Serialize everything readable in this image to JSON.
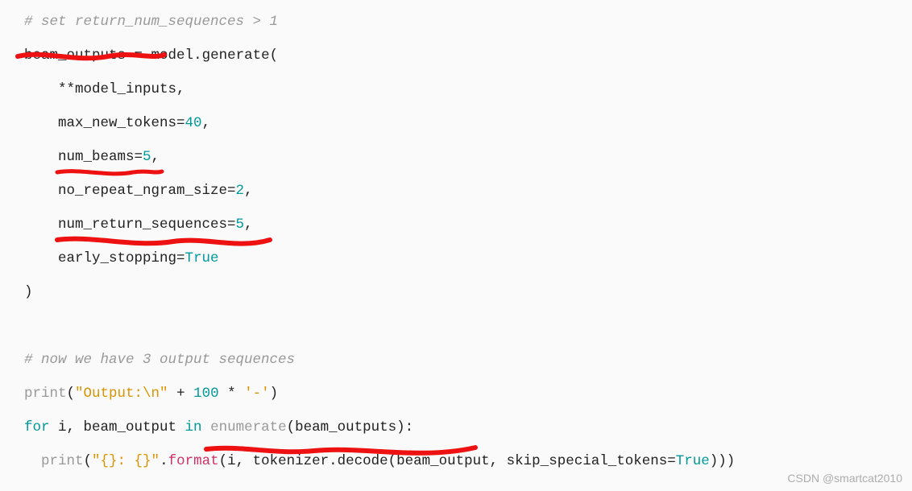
{
  "code": {
    "c1": "# set return_num_sequences > 1",
    "l1a": "beam_outputs ",
    "l1b": "=",
    "l1c": " model",
    "l1d": ".",
    "l1e": "generate",
    "l1f": "(",
    "l2a": "    **model_inputs",
    "l2b": ",",
    "l3a": "    max_new_tokens=",
    "l3b": "40",
    "l3c": ",",
    "l4a": "    num_beams=",
    "l4b": "5",
    "l4c": ",",
    "l5a": "    no_repeat_ngram_size=",
    "l5b": "2",
    "l5c": ",",
    "l6a": "    num_return_sequences=",
    "l6b": "5",
    "l6c": ",",
    "l7a": "    early_stopping=",
    "l7b": "True",
    "l8": ")",
    "blank": "",
    "c2": "# now we have 3 output sequences",
    "p1a": "print",
    "p1b": "(",
    "p1c": "\"Output:\\n\"",
    "p1d": " + ",
    "p1e": "100",
    "p1f": " * ",
    "p1g": "'-'",
    "p1h": ")",
    "f1a": "for",
    "f1b": " i, beam_output ",
    "f1c": "in",
    "f1d": " ",
    "f1e": "enumerate",
    "f1f": "(beam_outputs):",
    "g1a": "  ",
    "g1b": "print",
    "g1c": "(",
    "g1d": "\"{}: {}\"",
    "g1e": ".",
    "g1f": "format",
    "g1g": "(i, tokenizer",
    "g1h": ".",
    "g1i": "decode",
    "g1j": "(beam_output, skip_special_tokens=",
    "g1k": "True",
    "g1l": ")))"
  },
  "watermark": "CSDN @smartcat2010"
}
